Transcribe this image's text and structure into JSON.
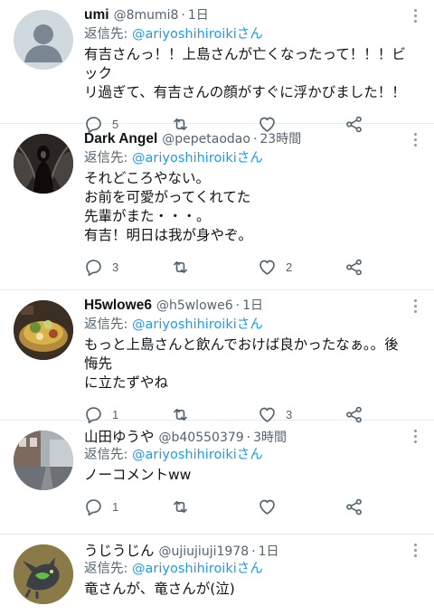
{
  "reply_prefix": "返信先: ",
  "tweets": [
    {
      "name": "umi",
      "handle": "@8mumi8",
      "time": "1日",
      "reply_to": "@ariyoshihiroikiさん",
      "text": "有吉さんっ！！上島さんが亡くなったって！！！ビック\nリ過ぎて、有吉さんの顔がすぐに浮かびました！！",
      "replies": "5",
      "retweets": "",
      "likes": "",
      "avatar": "default-avatar"
    },
    {
      "name": "Dark Angel",
      "handle": "@pepetaodao",
      "time": "23時間",
      "reply_to": "@ariyoshihiroikiさん",
      "text": "それどころやない。\nお前を可愛がってくれてた\n先輩がまた・・・。\n有吉！明日は我が身やぞ。",
      "replies": "3",
      "retweets": "",
      "likes": "2",
      "avatar": "dark-angel-avatar"
    },
    {
      "name": "H5wlowe6",
      "handle": "@h5wlowe6",
      "time": "1日",
      "reply_to": "@ariyoshihiroikiさん",
      "text": "もっと上島さんと飲んでおけば良かったなぁ。。後悔先\nに立たずやね",
      "replies": "1",
      "retweets": "",
      "likes": "3",
      "avatar": "food-avatar"
    },
    {
      "name": "山田ゆうや",
      "handle": "@b40550379",
      "time": "3時間",
      "reply_to": "@ariyoshihiroikiさん",
      "text": "ノーコメントww",
      "replies": "1",
      "retweets": "",
      "likes": "",
      "avatar": "street-avatar"
    },
    {
      "name": "うじうじん",
      "handle": "@ujiujiuji1978",
      "time": "1日",
      "reply_to": "@ariyoshihiroikiさん",
      "text": "竜さんが、竜さんが(泣)",
      "replies": "",
      "retweets": "",
      "likes": "",
      "avatar": "bird-avatar"
    }
  ],
  "colors": {
    "link": "#1d9bf0",
    "muted": "#536471",
    "divider": "#e6ecf0"
  },
  "icons": [
    "reply-icon",
    "retweet-icon",
    "like-icon",
    "share-icon",
    "more-icon"
  ]
}
